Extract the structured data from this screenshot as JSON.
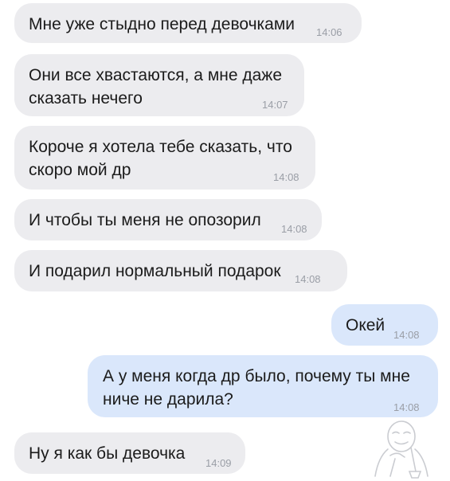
{
  "messages": [
    {
      "direction": "incoming",
      "text": "Мне уже стыдно перед девочками",
      "time": "14:06"
    },
    {
      "direction": "incoming",
      "text": "Они все хвастаются, а мне даже\nсказать нечего",
      "time": "14:07"
    },
    {
      "direction": "incoming",
      "text": "Короче я хотела тебе сказать, что\nскоро мой др",
      "time": "14:08"
    },
    {
      "direction": "incoming",
      "text": "И чтобы ты меня не опозорил",
      "time": "14:08"
    },
    {
      "direction": "incoming",
      "text": "И подарил нормальный подарок",
      "time": "14:08"
    },
    {
      "direction": "outgoing",
      "text": "Окей",
      "time": "14:08"
    },
    {
      "direction": "outgoing",
      "text": "А у меня когда др было, почему ты мне\nниче не дарила?",
      "time": "14:08"
    },
    {
      "direction": "incoming",
      "text": "Ну я как бы девочка",
      "time": "14:09"
    }
  ],
  "colors": {
    "incoming_bubble": "#ececef",
    "outgoing_bubble": "#dae7fb",
    "message_text": "#1b1b1b",
    "time_text": "#9a9ea6"
  },
  "watermark_icon": "sipping-meme-face-icon"
}
